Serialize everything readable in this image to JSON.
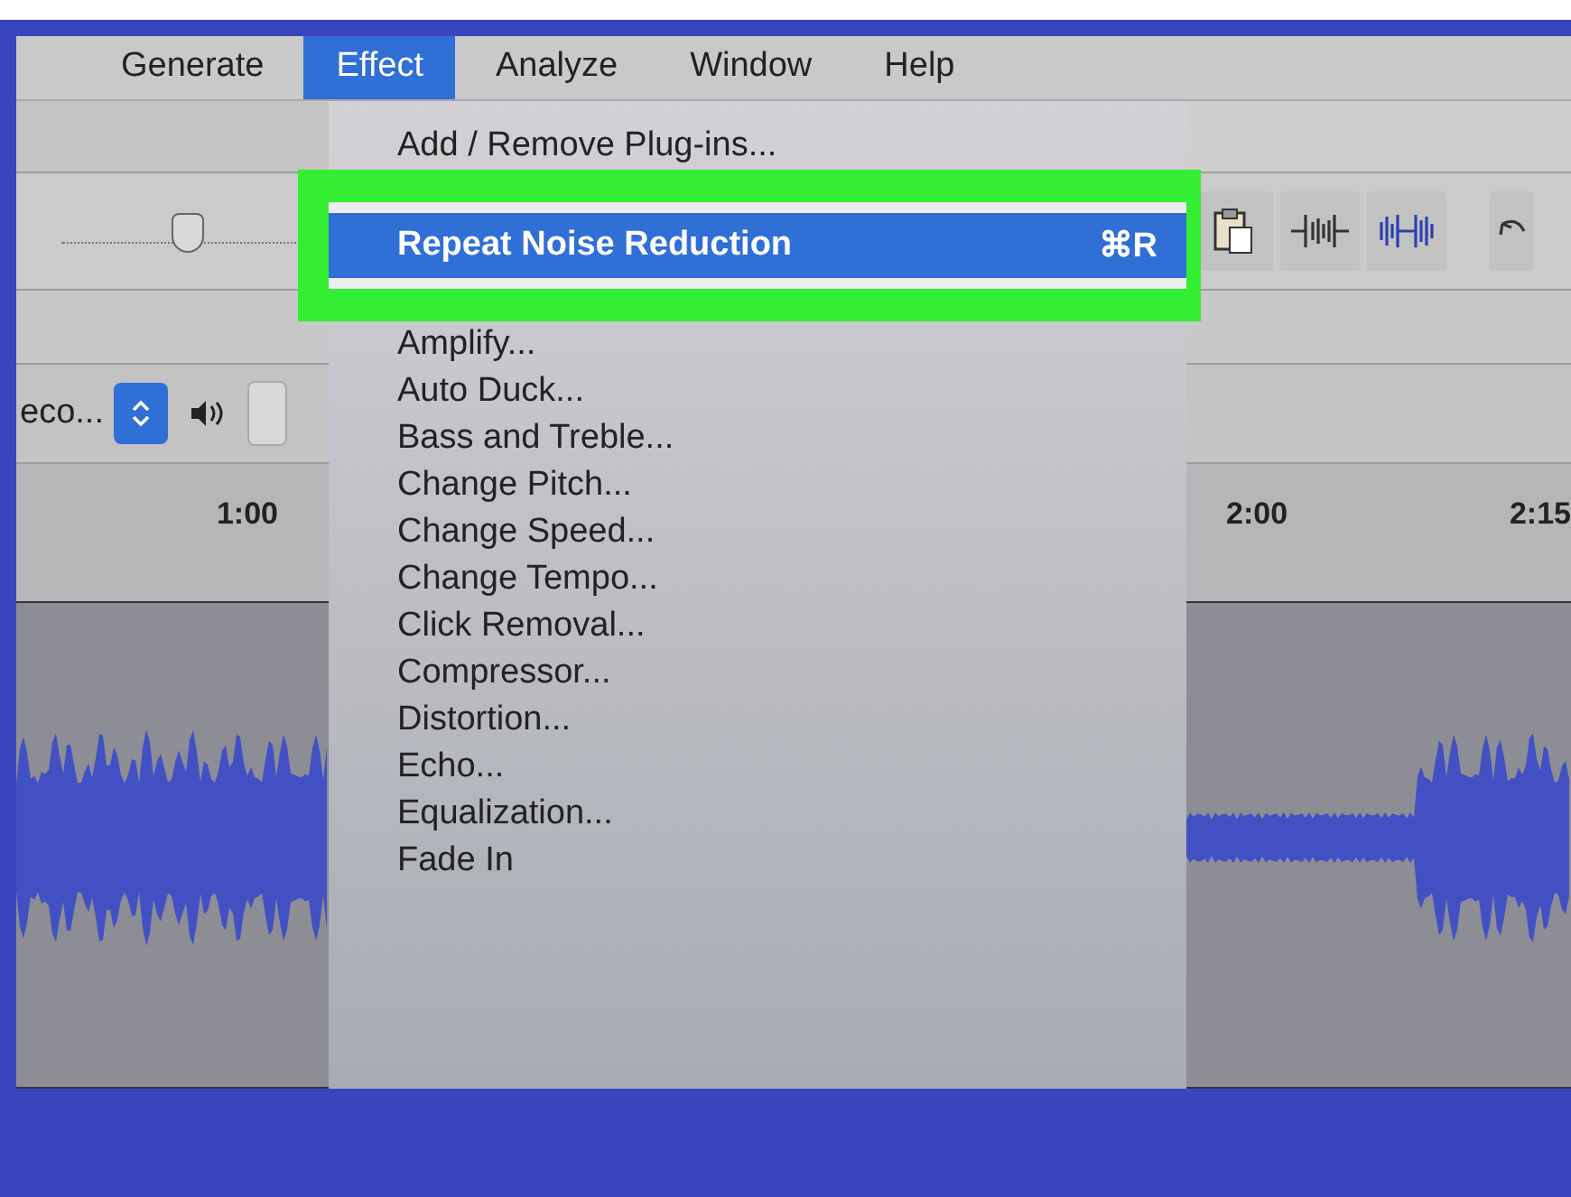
{
  "menu_bar": {
    "items": [
      {
        "label": "Generate",
        "selected": false
      },
      {
        "label": "Effect",
        "selected": true
      },
      {
        "label": "Analyze",
        "selected": false
      },
      {
        "label": "Window",
        "selected": false
      },
      {
        "label": "Help",
        "selected": false
      }
    ]
  },
  "device": {
    "label": "eco..."
  },
  "gain_slider": {
    "level": 0.5
  },
  "timeline": {
    "left_labels": [
      "1:00"
    ],
    "right_labels": [
      "2:00",
      "2:15"
    ]
  },
  "effect_menu": {
    "items": [
      {
        "kind": "item",
        "label": "Add / Remove Plug-ins...",
        "selected": false,
        "outlined": false
      },
      {
        "kind": "item",
        "label": "Repeat Noise Reduction",
        "shortcut": "⌘R",
        "selected": true,
        "outlined": true
      },
      {
        "kind": "item",
        "label": "Amplify...",
        "selected": false,
        "outlined": false
      },
      {
        "kind": "item",
        "label": "Auto Duck...",
        "selected": false,
        "outlined": false
      },
      {
        "kind": "item",
        "label": "Bass and Treble...",
        "selected": false,
        "outlined": false
      },
      {
        "kind": "item",
        "label": "Change Pitch...",
        "selected": false,
        "outlined": false
      },
      {
        "kind": "item",
        "label": "Change Speed...",
        "selected": false,
        "outlined": false
      },
      {
        "kind": "item",
        "label": "Change Tempo...",
        "selected": false,
        "outlined": false
      },
      {
        "kind": "item",
        "label": "Click Removal...",
        "selected": false,
        "outlined": false
      },
      {
        "kind": "item",
        "label": "Compressor...",
        "selected": false,
        "outlined": false
      },
      {
        "kind": "item",
        "label": "Distortion...",
        "selected": false,
        "outlined": false
      },
      {
        "kind": "item",
        "label": "Echo...",
        "selected": false,
        "outlined": false
      },
      {
        "kind": "item",
        "label": "Equalization...",
        "selected": false,
        "outlined": false
      },
      {
        "kind": "item",
        "label": "Fade In",
        "selected": false,
        "outlined": false
      }
    ]
  }
}
